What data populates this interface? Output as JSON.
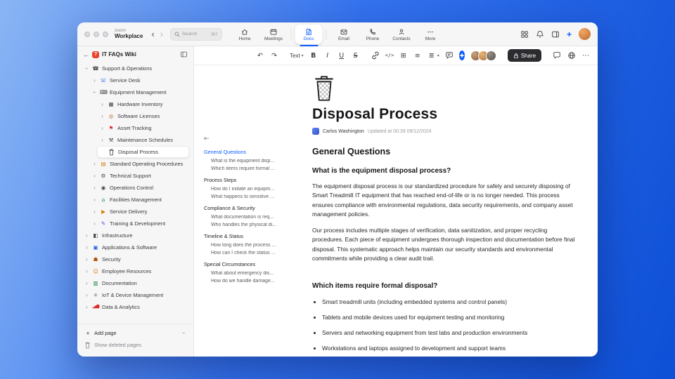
{
  "chrome": {
    "brand_top": "zoom",
    "brand_bottom": "Workplace",
    "back_icon": "‹",
    "forward_icon": "›",
    "search": {
      "placeholder": "Search",
      "shortcut": "⌘F"
    },
    "tabs": [
      {
        "label": "Home"
      },
      {
        "label": "Meetings"
      },
      {
        "label": "Docs",
        "active": true
      },
      {
        "label": "Email"
      },
      {
        "label": "Phone"
      },
      {
        "label": "Contacts"
      },
      {
        "label": "More"
      }
    ],
    "new_plus": "+",
    "accent": "#0b5cff"
  },
  "sidebar": {
    "back_icon": "←",
    "badge": "?",
    "title": "IT FAQs Wiki",
    "chevron": "›",
    "tree": [
      {
        "label": "Support & Operations",
        "glyph": "☎"
      },
      {
        "label": "Service Desk",
        "glyph": "☏"
      },
      {
        "label": "Equipment Management",
        "glyph": "⌨"
      },
      {
        "label": "Hardware Inventory",
        "glyph": "▦"
      },
      {
        "label": "Software Licenses",
        "glyph": "◎"
      },
      {
        "label": "Asset Tracking",
        "glyph": "⚑"
      },
      {
        "label": "Maintenance Schedules",
        "glyph": "⚒"
      },
      {
        "label": "Disposal Process"
      },
      {
        "label": "Standard Operating Procedures",
        "glyph": "▤"
      },
      {
        "label": "Technical Support",
        "glyph": "⚙"
      },
      {
        "label": "Operations Control",
        "glyph": "◉"
      },
      {
        "label": "Facilities Management",
        "glyph": "⌂"
      },
      {
        "label": "Service Delivery",
        "glyph": "▶"
      },
      {
        "label": "Training & Development",
        "glyph": "✎"
      },
      {
        "label": "Infrastructure",
        "glyph": "◧"
      },
      {
        "label": "Applications & Software",
        "glyph": "▣"
      },
      {
        "label": "Security",
        "glyph": "☗"
      },
      {
        "label": "Employee Resources",
        "glyph": "☺"
      },
      {
        "label": "Documentation",
        "glyph": "▥"
      },
      {
        "label": "IoT & Device Management",
        "glyph": "⚛"
      },
      {
        "label": "Data & Analytics",
        "glyph": "▂▅▇"
      }
    ],
    "footer": {
      "add_plus": "+",
      "add_label": "Add page",
      "deleted_label": "Show deleted pages"
    }
  },
  "toolbar": {
    "undo": "↶",
    "redo": "↷",
    "text_style": "Text",
    "caret": "▾",
    "bold": "B",
    "italic": "I",
    "underline": "U",
    "strike": "S",
    "code": "</>",
    "table": "⊞",
    "list": "≡",
    "align": "≣",
    "share": "Share",
    "more": "⋯"
  },
  "outline": {
    "collapse_icon": "⇤",
    "sections": [
      {
        "label": "General Questions",
        "active": true,
        "children": [
          "What is the equipment disp...",
          "Which items require formal ..."
        ]
      },
      {
        "label": "Process Steps",
        "children": [
          "How do I initiate an equipm...",
          "What happens to sensitive ..."
        ]
      },
      {
        "label": "Compliance & Security",
        "children": [
          "What documentation is req...",
          "Who handles the physical di..."
        ]
      },
      {
        "label": "Timeline & Status",
        "children": [
          "How long does the process ...",
          "How can I check the status ..."
        ]
      },
      {
        "label": "Special Circumstances",
        "children": [
          "What about emergency dis...",
          "How do we handle damage..."
        ]
      }
    ]
  },
  "doc": {
    "title": "Disposal Process",
    "author": "Carlos Washington",
    "updated": "Updated at 00:39 09/12/2024",
    "section1": "General Questions",
    "q1": "What is the equipment disposal process?",
    "p1": "The equipment disposal process is our standardized procedure for safely and securely disposing of Smart Treadmill IT equipment that has reached end-of-life or is no longer needed. This process ensures compliance with environmental regulations, data security requirements, and company asset management policies.",
    "p2": "Our process includes multiple stages of verification, data sanitization, and proper recycling procedures. Each piece of equipment undergoes thorough inspection and documentation before final disposal. This systematic approach helps maintain our security standards and environmental commitments while providing a clear audit trail.",
    "q2": "Which items require formal disposal?",
    "bullets": [
      "Smart treadmill units (including embedded systems and control panels)",
      "Tablets and mobile devices used for equipment testing and monitoring",
      "Servers and networking equipment from test labs and production environments",
      "Workstations and laptops assigned to development and support teams"
    ]
  }
}
